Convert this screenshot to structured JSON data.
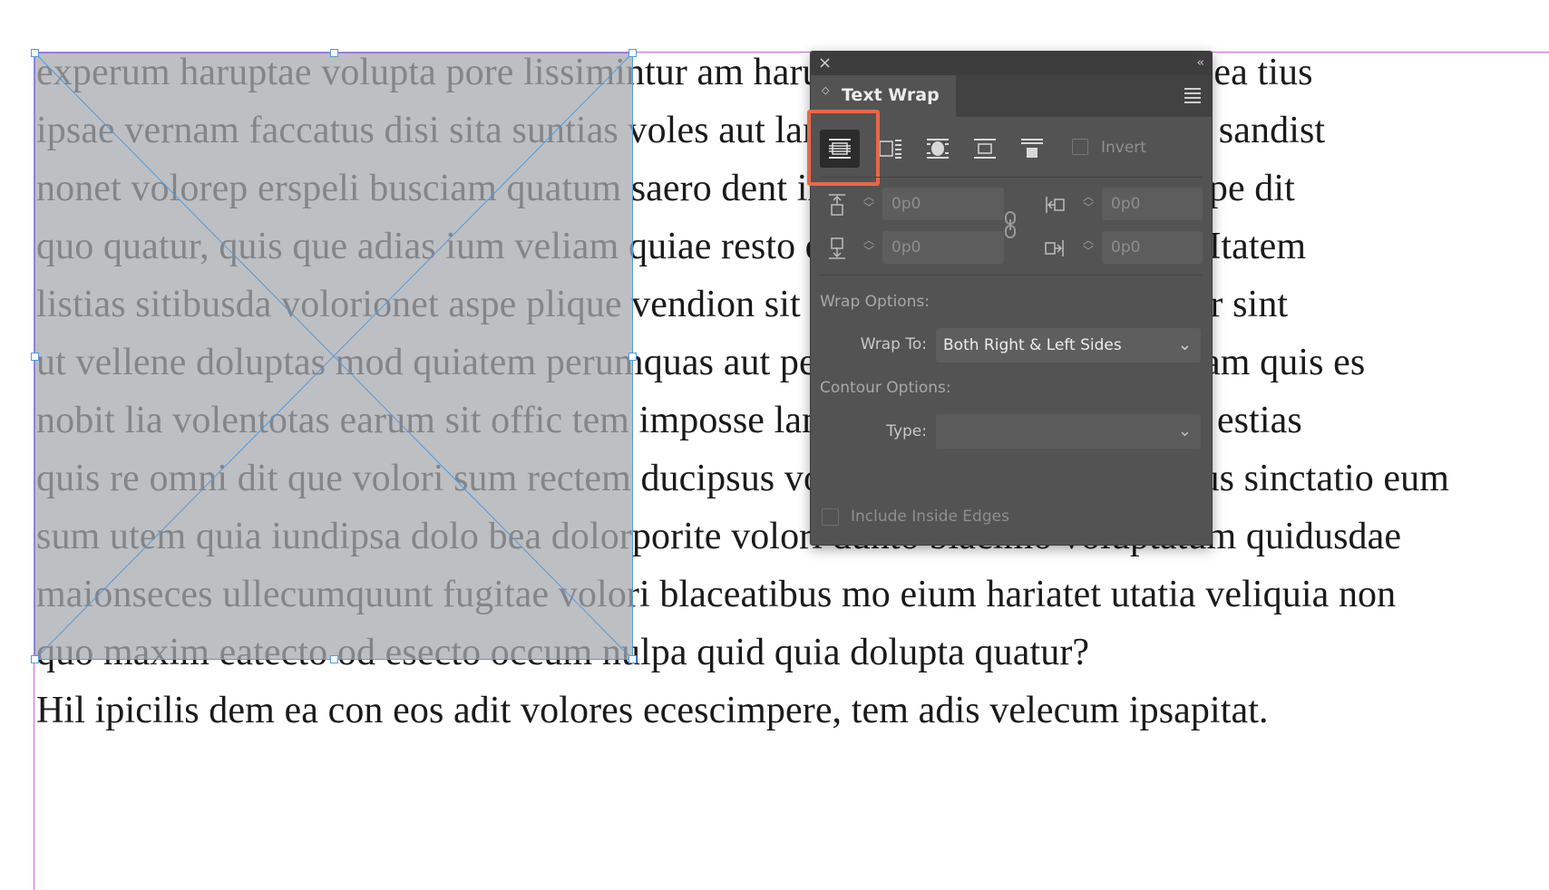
{
  "document": {
    "lines": [
      "experum haruptae volupta pore lissimintur am harum ipsantur dolorem corecea tius",
      "ipsae vernam faccatus disi sita suntias voles aut lam id moluptias est, sum es sandist",
      "nonet volorep erspeli busciam quatum saero dent ilicius voluptiorae corepre pe dit",
      "quo quatur, quis que adias ium veliam quiae resto quid mod dolum explabo. Itatem",
      "listias sitibusda volorionet aspe plique vendion sit que non seque eruptas pror sint",
      "ut vellene doluptas mod quiatem perumquas aut pedi dolent quis iliquis musam quis es",
      "nobit lia volentotas earum sit offic tem imposse lam reptatis utatent is ad mo estias",
      "quis re omni dit que volori sum rectem ducipsus volorese quatin neque consus sinctatio eum",
      "sum utem quia iundipsa dolo bea dolorporite volori dunto blacimo voluptatum quidusdae",
      "maionseces ullecumquunt fugitae volori blaceatibus mo eium hariatet utatia veliquia non",
      "quo maxim eatecto od esecto occum nulpa quid quia dolupta quatur?",
      "Hil ipicilis dem ea con eos adit volores ecescimpere, tem adis velecum ipsapitat."
    ]
  },
  "panel": {
    "close_icon": "×",
    "collapse_icon": "‹‹",
    "tab_label": "Text Wrap",
    "wrap_buttons": [
      {
        "name": "no-text-wrap",
        "selected": true
      },
      {
        "name": "wrap-around-bounding-box",
        "selected": false
      },
      {
        "name": "wrap-around-object-shape",
        "selected": false
      },
      {
        "name": "jump-object",
        "selected": false
      },
      {
        "name": "jump-to-next-column",
        "selected": false
      }
    ],
    "invert_label": "Invert",
    "offsets": {
      "top": "0p0",
      "bottom": "0p0",
      "left": "0p0",
      "right": "0p0"
    },
    "wrap_options_label": "Wrap Options:",
    "wrap_to_label": "Wrap To:",
    "wrap_to_value": "Both Right & Left Sides",
    "contour_options_label": "Contour Options:",
    "type_label": "Type:",
    "type_value": "",
    "include_inside_edges_label": "Include Inside Edges"
  },
  "colors": {
    "panel_bg": "#535353",
    "highlight": "#e8684a",
    "frame_selection": "#4f9be0",
    "margin_guide": "#c86bd6"
  }
}
